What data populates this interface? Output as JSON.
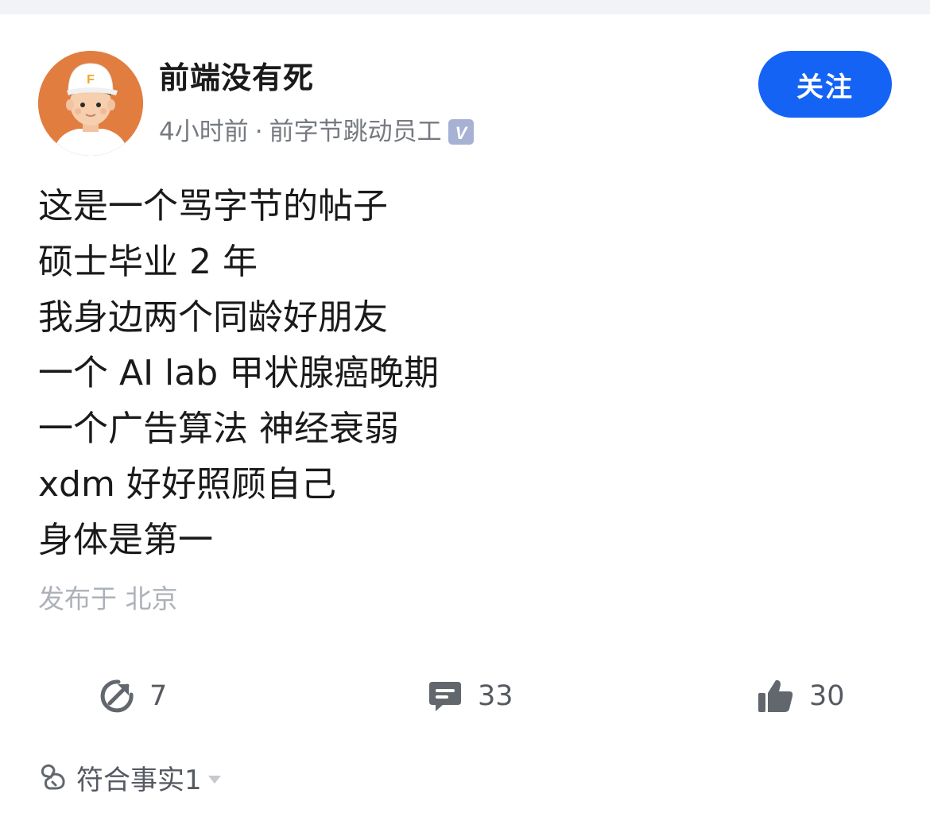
{
  "post": {
    "author": {
      "name": "前端没有死",
      "time": "4小时前",
      "separator": "·",
      "title": "前字节跳动员工",
      "verified_badge": "V",
      "avatar_cap_letter": "F"
    },
    "follow_label": "关注",
    "content_lines": [
      "这是一个骂字节的帖子",
      "硕士毕业 2 年",
      "我身边两个同龄好朋友",
      "一个 AI lab 甲状腺癌晚期",
      "一个广告算法 神经衰弱",
      "xdm 好好照顾自己",
      "身体是第一"
    ],
    "location": "发布于 北京"
  },
  "actions": {
    "share": {
      "icon": "share-icon",
      "count": "7"
    },
    "comment": {
      "icon": "comment-icon",
      "count": "33"
    },
    "like": {
      "icon": "thumbs-up-icon",
      "count": "30"
    }
  },
  "fact_check": {
    "icon": "fact-check-icon",
    "label": "符合事实",
    "count": "1"
  },
  "colors": {
    "accent": "#1463f5",
    "text_primary": "#1a1a1a",
    "text_secondary": "#767a80",
    "text_muted": "#adb1b8",
    "icon": "#62676e",
    "avatar_bg": "#e27d40",
    "badge": "#a7b1d4"
  }
}
